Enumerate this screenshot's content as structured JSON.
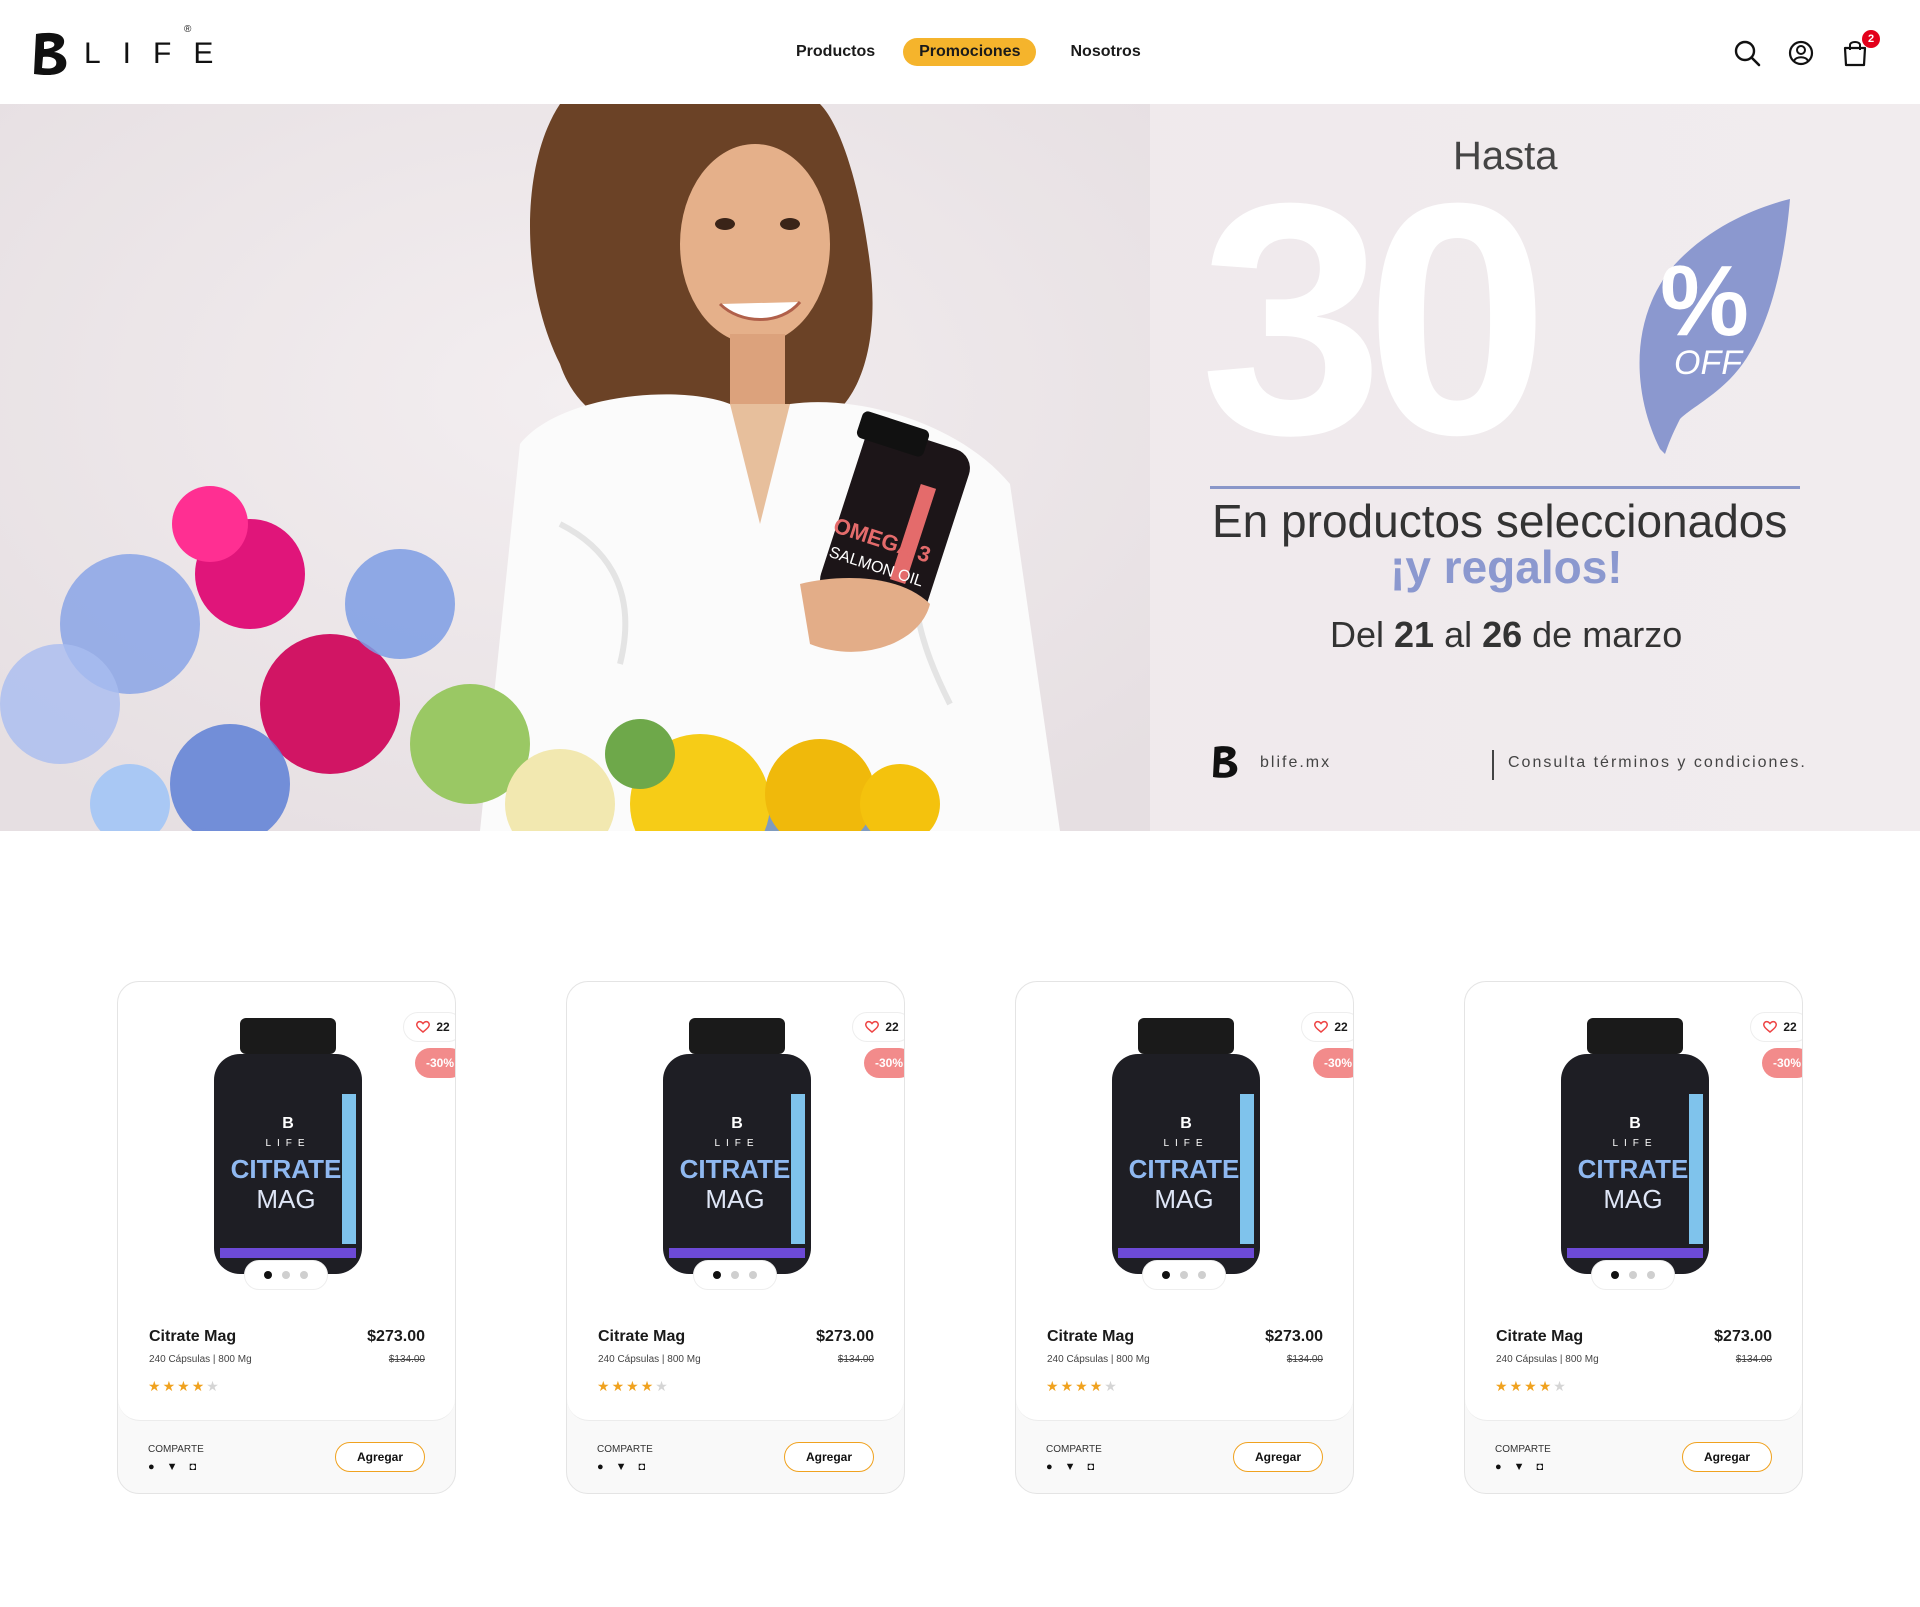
{
  "header": {
    "brand": "LIFE",
    "nav": [
      "Productos",
      "Promociones",
      "Nosotros"
    ],
    "cart_count": "2"
  },
  "hero": {
    "hasta": "Hasta",
    "big": "30",
    "pct": "%",
    "off": "OFF",
    "line1": "En productos seleccionados",
    "line2": "¡y regalos!",
    "date_pre": "Del ",
    "date_a": "21",
    "date_mid": " al ",
    "date_b": "26",
    "date_post": " de marzo",
    "url": "blife.mx",
    "terms": "Consulta términos y condiciones.",
    "bottle_label_1": "OMEGA 3",
    "bottle_label_2": "SALMON OIL"
  },
  "colors": {
    "accent": "#f5b42c",
    "leaf": "#8b98cf",
    "discount": "#f28b8b",
    "badge": "#e3001b"
  },
  "products": [
    {
      "name": "Citrate Mag",
      "desc": "240 Cápsulas | 800 Mg",
      "price": "$273.00",
      "old_price": "$134.00",
      "likes": "22",
      "discount": "-30%",
      "rating": 3.5,
      "share": "COMPARTE",
      "cta": "Agregar",
      "bottle_text_1": "CITRATE",
      "bottle_text_2": "MAG",
      "bottle_brand": "LIFE"
    },
    {
      "name": "Citrate Mag",
      "desc": "240 Cápsulas | 800 Mg",
      "price": "$273.00",
      "old_price": "$134.00",
      "likes": "22",
      "discount": "-30%",
      "rating": 3.5,
      "share": "COMPARTE",
      "cta": "Agregar",
      "bottle_text_1": "CITRATE",
      "bottle_text_2": "MAG",
      "bottle_brand": "LIFE"
    },
    {
      "name": "Citrate Mag",
      "desc": "240 Cápsulas | 800 Mg",
      "price": "$273.00",
      "old_price": "$134.00",
      "likes": "22",
      "discount": "-30%",
      "rating": 3.5,
      "share": "COMPARTE",
      "cta": "Agregar",
      "bottle_text_1": "CITRATE",
      "bottle_text_2": "MAG",
      "bottle_brand": "LIFE"
    },
    {
      "name": "Citrate Mag",
      "desc": "240 Cápsulas | 800 Mg",
      "price": "$273.00",
      "old_price": "$134.00",
      "likes": "22",
      "discount": "-30%",
      "rating": 3.5,
      "share": "COMPARTE",
      "cta": "Agregar",
      "bottle_text_1": "CITRATE",
      "bottle_text_2": "MAG",
      "bottle_brand": "LIFE"
    }
  ]
}
